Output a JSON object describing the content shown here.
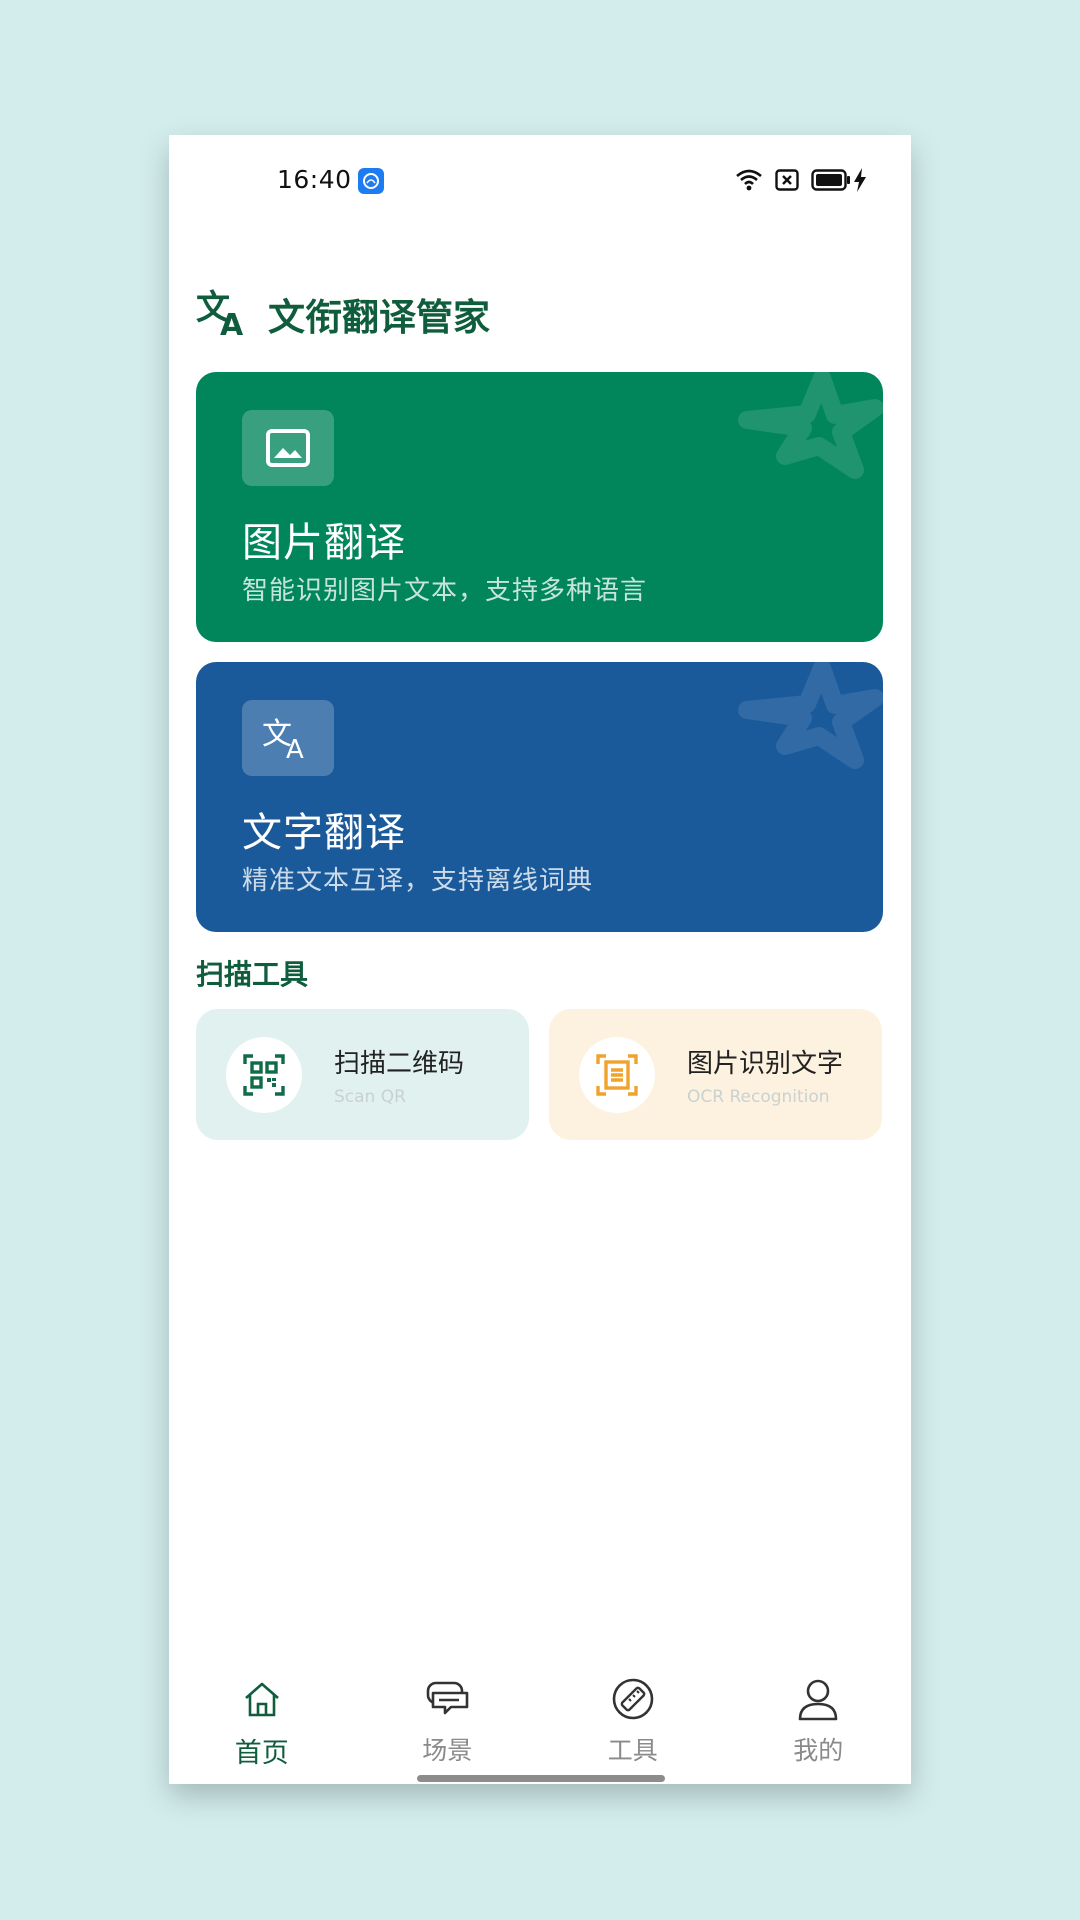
{
  "status_bar": {
    "time": "16:40",
    "app_icon": "cloud-app-icon",
    "icons": [
      "wifi-icon",
      "no-sim-icon",
      "battery-icon",
      "charging-icon"
    ]
  },
  "header": {
    "logo_icon": "translate-icon",
    "title": "文衔翻译管家"
  },
  "feature_cards": [
    {
      "title": "图片翻译",
      "subtitle": "智能识别图片文本，支持多种语言",
      "icon": "image-icon",
      "color": "#00865a"
    },
    {
      "title": "文字翻译",
      "subtitle": "精准文本互译，支持离线词典",
      "icon": "translate-icon",
      "color": "#1a5a9b"
    }
  ],
  "scan_tools": {
    "section_title": "扫描工具",
    "items": [
      {
        "title": "扫描二维码",
        "subtitle": "Scan QR",
        "icon": "qr-scan-icon",
        "color": "#0f6b48"
      },
      {
        "title": "图片识别文字",
        "subtitle": "OCR Recognition",
        "icon": "ocr-scan-icon",
        "color": "#f0a32c"
      }
    ]
  },
  "bottom_nav": {
    "items": [
      {
        "label": "首页",
        "icon": "home-icon",
        "active": true
      },
      {
        "label": "场景",
        "icon": "chat-bubbles-icon",
        "active": false
      },
      {
        "label": "工具",
        "icon": "ruler-icon",
        "active": false
      },
      {
        "label": "我的",
        "icon": "user-icon",
        "active": false
      }
    ]
  }
}
